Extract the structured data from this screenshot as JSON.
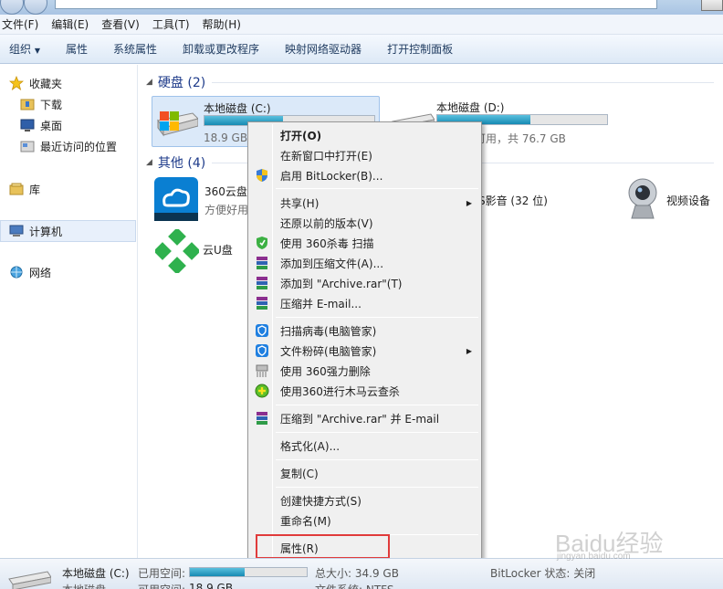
{
  "menubar": {
    "items": [
      "文件(F)",
      "编辑(E)",
      "查看(V)",
      "工具(T)",
      "帮助(H)"
    ]
  },
  "toolbar": {
    "organize": "组织",
    "items": [
      "属性",
      "系统属性",
      "卸载或更改程序",
      "映射网络驱动器",
      "打开控制面板"
    ]
  },
  "sidebar": {
    "favorites": "收藏夹",
    "downloads": "下载",
    "desktop": "桌面",
    "recent": "最近访问的位置",
    "library": "库",
    "computer": "计算机",
    "network": "网络"
  },
  "main": {
    "group_hdd": "硬盘 (2)",
    "group_other": "其他 (4)",
    "drive_c": {
      "name": "本地磁盘 (C:)",
      "size_text": "18.9 GB",
      "used_fraction": 0.46
    },
    "drive_d": {
      "name": "本地磁盘 (D:)",
      "size_text": "可用，共 76.7 GB",
      "used_fraction": 0.55
    },
    "yun360_name": "360云盘",
    "yun360_desc": "方便好用",
    "yingyin_name": "S影音 (32 位)",
    "video_device": "视频设备",
    "yunu": "云U盘"
  },
  "context_menu": {
    "open": "打开(O)",
    "open_new_window": "在新窗口中打开(E)",
    "bitlocker": "启用 BitLocker(B)...",
    "share": "共享(H)",
    "restore": "还原以前的版本(V)",
    "scan360": "使用 360杀毒 扫描",
    "add_archive": "添加到压缩文件(A)...",
    "add_archive_rar": "添加到 \"Archive.rar\"(T)",
    "compress_email": "压缩并 E-mail...",
    "scan_virus": "扫描病毒(电脑管家)",
    "shred": "文件粉碎(电脑管家)",
    "force_delete": "使用 360强力删除",
    "trojan_scan": "使用360进行木马云查杀",
    "compress_rar_email": "压缩到 \"Archive.rar\" 并 E-mail",
    "format": "格式化(A)...",
    "copy": "复制(C)",
    "create_shortcut": "创建快捷方式(S)",
    "rename": "重命名(M)",
    "properties": "属性(R)"
  },
  "statusbar": {
    "drive_name": "本地磁盘 (C:)",
    "drive_type": "本地磁盘",
    "used_label": "已用空间:",
    "free_label": "可用空间:",
    "free_value": "18.9 GB",
    "total_label": "总大小: 34.9 GB",
    "fs_label": "文件系统: NTFS",
    "bitlocker_label": "BitLocker 状态: 关闭",
    "used_fraction": 0.47
  },
  "watermark": {
    "text": "Baidu经验",
    "url": "jingyan.baidu.com"
  }
}
